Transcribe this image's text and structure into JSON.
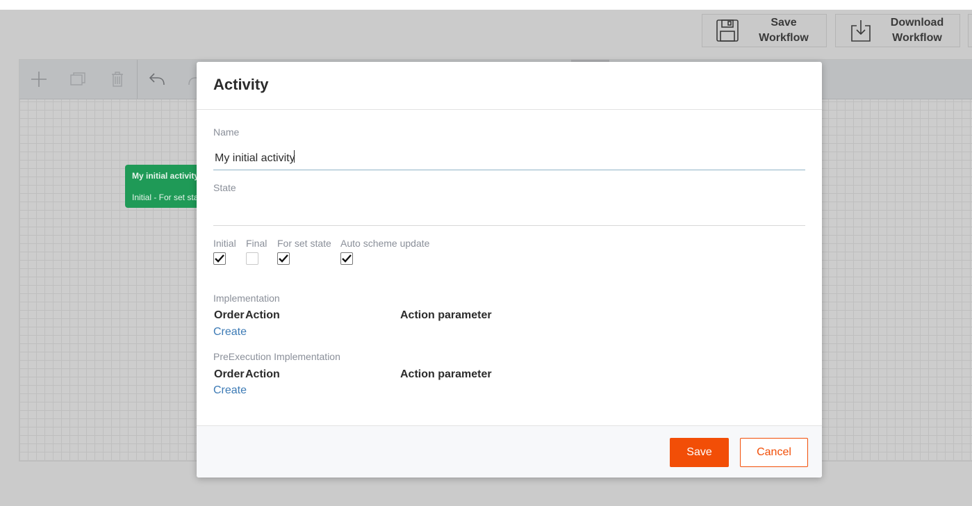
{
  "header": {
    "save_workflow": "Save\nWorkflow",
    "save_line1": "Save",
    "save_line2": "Workflow",
    "download_line1": "Download",
    "download_line2": "Workflow"
  },
  "toolbar": {
    "icons": [
      "plus-icon",
      "copy-icon",
      "trash-icon",
      "undo-icon",
      "redo-icon"
    ]
  },
  "canvas": {
    "node": {
      "name": "My initial activity",
      "state": "Initial - For set state"
    }
  },
  "modal": {
    "title": "Activity",
    "name_label": "Name",
    "name_value": "My initial activity",
    "state_label": "State",
    "state_value": "",
    "checkboxes": [
      {
        "label": "Initial",
        "checked": true
      },
      {
        "label": "Final",
        "checked": false
      },
      {
        "label": "For set state",
        "checked": true
      },
      {
        "label": "Auto scheme update",
        "checked": true
      }
    ],
    "implementation": {
      "label": "Implementation",
      "col_order": "Order",
      "col_action": "Action",
      "col_param": "Action parameter",
      "create": "Create"
    },
    "pre_implementation": {
      "label": "PreExecution Implementation",
      "col_order": "Order",
      "col_action": "Action",
      "col_param": "Action parameter",
      "create": "Create"
    },
    "footer": {
      "save": "Save",
      "cancel": "Cancel"
    }
  },
  "colors": {
    "accent": "#f24e07",
    "node_green": "#1f9a57",
    "link_blue": "#3c7ab5"
  }
}
